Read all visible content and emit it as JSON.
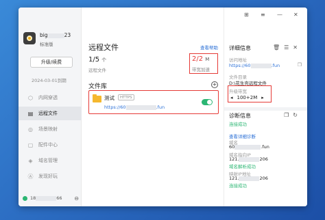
{
  "sidebar": {
    "user_name_start": "big",
    "user_name_end": "23",
    "edition": "标准版",
    "upgrade_label": "升级/续费",
    "expire": "2024-03-01到期",
    "items": [
      {
        "label": "内网穿透",
        "icon": "globe-icon"
      },
      {
        "label": "远程文件",
        "icon": "folder-icon"
      },
      {
        "label": "场景映射",
        "icon": "scene-icon"
      },
      {
        "label": "配件中心",
        "icon": "accessory-icon"
      },
      {
        "label": "域名管理",
        "icon": "domain-icon"
      },
      {
        "label": "发现好玩",
        "icon": "discover-icon"
      }
    ],
    "active_index": 1,
    "footer_id_start": "18",
    "footer_id_end": "66"
  },
  "main": {
    "title": "远程文件",
    "help_link": "查看帮助",
    "stat_files_value": "1/5",
    "stat_files_unit": "个",
    "stat_files_label": "远程文件",
    "stat_bw_value": "2/2",
    "stat_bw_unit": "M",
    "stat_bw_label": "带宽加速",
    "library_title": "文件库",
    "library_item": {
      "name": "测试",
      "tag": "HTTPS",
      "url_start": "https://60",
      "url_end": ".fun",
      "enabled": true
    }
  },
  "detail": {
    "title": "详细信息",
    "access_label": "访问地址",
    "access_url_start": "https://60",
    "access_url_end": ".fun",
    "dir_label": "文件目录",
    "dir_value": "D:\\花生壳远程文件",
    "bandwidth_label": "升级带宽",
    "bandwidth_value": "100+2M",
    "diag_title": "诊断信息",
    "diag_status": "连接成功",
    "diag_link": "查看详细诊断",
    "domain_label": "域名",
    "domain_start": "60",
    "domain_end": ".fun",
    "resolve_label": "域名指向IP",
    "resolve_ip_start": "121.",
    "resolve_ip_end": "206",
    "resolve_status": "域名解析成功",
    "map_label": "映射IP地址",
    "map_ip_start": "121.",
    "map_ip_end": "206",
    "map_status": "连接成功"
  },
  "colors": {
    "accent": "#2a6fd6",
    "success": "#2bb673",
    "highlight": "#e53935"
  }
}
